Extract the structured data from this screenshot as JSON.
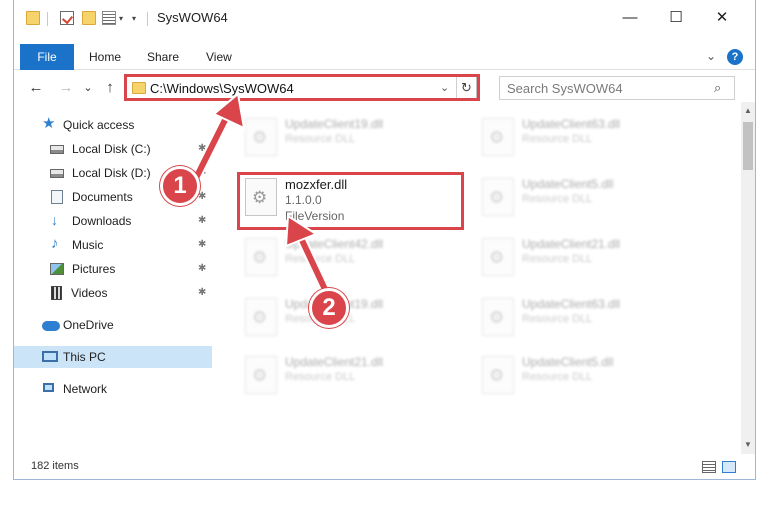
{
  "window": {
    "title": "SysWOW64",
    "minimize": "—",
    "maximize": "☐",
    "close": "✕"
  },
  "ribbon": {
    "tabs": [
      "File",
      "Home",
      "Share",
      "View"
    ],
    "expand": "⌄",
    "help": "?"
  },
  "nav": {
    "back": "←",
    "forward": "→",
    "recent": "⌄",
    "up": "↑",
    "address": "C:\\Windows\\SysWOW64",
    "address_dropdown": "⌄",
    "refresh": "↻",
    "search_placeholder": "Search SysWOW64",
    "search_icon": "⌕"
  },
  "sidebar": {
    "items": [
      {
        "label": "Quick access",
        "icon": "star-icon",
        "pinned": false
      },
      {
        "label": "Local Disk (C:)",
        "icon": "disk-icon",
        "pinned": true
      },
      {
        "label": "Local Disk (D:)",
        "icon": "disk-icon",
        "pinned": true
      },
      {
        "label": "Documents",
        "icon": "documents-icon",
        "pinned": true
      },
      {
        "label": "Downloads",
        "icon": "download-icon",
        "pinned": true
      },
      {
        "label": "Music",
        "icon": "music-icon",
        "pinned": true
      },
      {
        "label": "Pictures",
        "icon": "pictures-icon",
        "pinned": true
      },
      {
        "label": "Videos",
        "icon": "videos-icon",
        "pinned": true
      },
      {
        "label": "OneDrive",
        "icon": "onedrive-icon",
        "pinned": false
      },
      {
        "label": "This PC",
        "icon": "this-pc-icon",
        "pinned": false,
        "selected": true
      },
      {
        "label": "Network",
        "icon": "network-icon",
        "pinned": false
      }
    ],
    "pin_glyph": "📌"
  },
  "files": {
    "focus": {
      "name": "mozxfer.dll",
      "version": "1.1.0.0",
      "desc": "FileVersion"
    },
    "blurred": [
      {
        "name": "UpdateClient19.dll",
        "type": "Resource DLL"
      },
      {
        "name": "UpdateClient63.dll",
        "type": "Resource DLL"
      },
      {
        "name": "UpdateClient5.dll",
        "type": "Resource DLL"
      },
      {
        "name": "UpdateClient42.dll",
        "type": "Resource DLL"
      },
      {
        "name": "UpdateClient21.dll",
        "type": "Resource DLL"
      },
      {
        "name": "UpdateClient19.dll",
        "type": "Resource DLL"
      },
      {
        "name": "UpdateClient63.dll",
        "type": "Resource DLL"
      },
      {
        "name": "UpdateClient21.dll",
        "type": "Resource DLL"
      },
      {
        "name": "UpdateClient5.dll",
        "type": "Resource DLL"
      }
    ]
  },
  "scroll": {
    "up": "▲",
    "down": "▼"
  },
  "status": {
    "item_count": "182 items"
  },
  "annotations": {
    "step1": "1",
    "step2": "2"
  },
  "colors": {
    "accent": "#1a73c9",
    "highlight": "#d9454a",
    "selected": "#cce4f7"
  }
}
